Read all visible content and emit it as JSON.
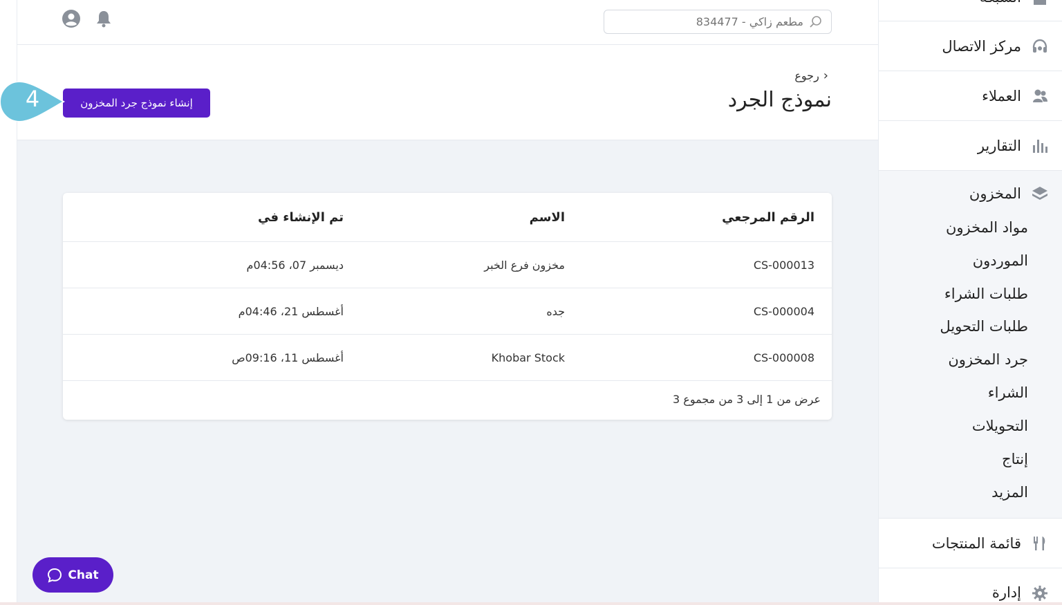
{
  "topbar": {
    "search_placeholder": "مطعم زاكي - 834477",
    "icons": [
      "account-circle-icon",
      "bell-icon",
      "search-icon"
    ]
  },
  "header": {
    "back_label": "رجوع",
    "title": "نموذج الجرد",
    "create_button": "إنشاء نموذج جرد المخزون",
    "step_number": "4"
  },
  "table": {
    "columns": [
      "الرقم المرجعي",
      "الاسم",
      "تم الإنشاء في"
    ],
    "rows": [
      {
        "ref": "CS-000013",
        "name": "مخزون فرع الخبر",
        "created": "ديسمبر 07، 04:56م"
      },
      {
        "ref": "CS-000004",
        "name": "جده",
        "created": "أغسطس 21، 04:46م"
      },
      {
        "ref": "CS-000008",
        "name": "Khobar Stock",
        "created": "أغسطس 11، 09:16ص"
      }
    ],
    "footer": "عرض من 1 إلى 3 من مجموع 3"
  },
  "chat": {
    "label": "Chat"
  },
  "sidebar": {
    "top_partial": "الشبكة",
    "items": [
      {
        "label": "مركز الاتصال",
        "icon": "headset-icon"
      },
      {
        "label": "العملاء",
        "icon": "customers-icon"
      },
      {
        "label": "التقارير",
        "icon": "bar-chart-icon"
      }
    ],
    "inventory": {
      "label": "المخزون",
      "icon": "layers-icon",
      "subitems": [
        "مواد المخزون",
        "الموردون",
        "طلبات الشراء",
        "طلبات التحويل",
        "جرد المخزون",
        "الشراء",
        "التحويلات",
        "إنتاج",
        "المزيد"
      ]
    },
    "bottom_items": [
      {
        "label": "قائمة المنتجات",
        "icon": "fork-knife-icon"
      },
      {
        "label": "إدارة",
        "icon": "gear-icon"
      }
    ]
  },
  "colors": {
    "primary": "#5a1fc9",
    "badge": "#6cc3dc",
    "background": "#f0f3f7"
  }
}
